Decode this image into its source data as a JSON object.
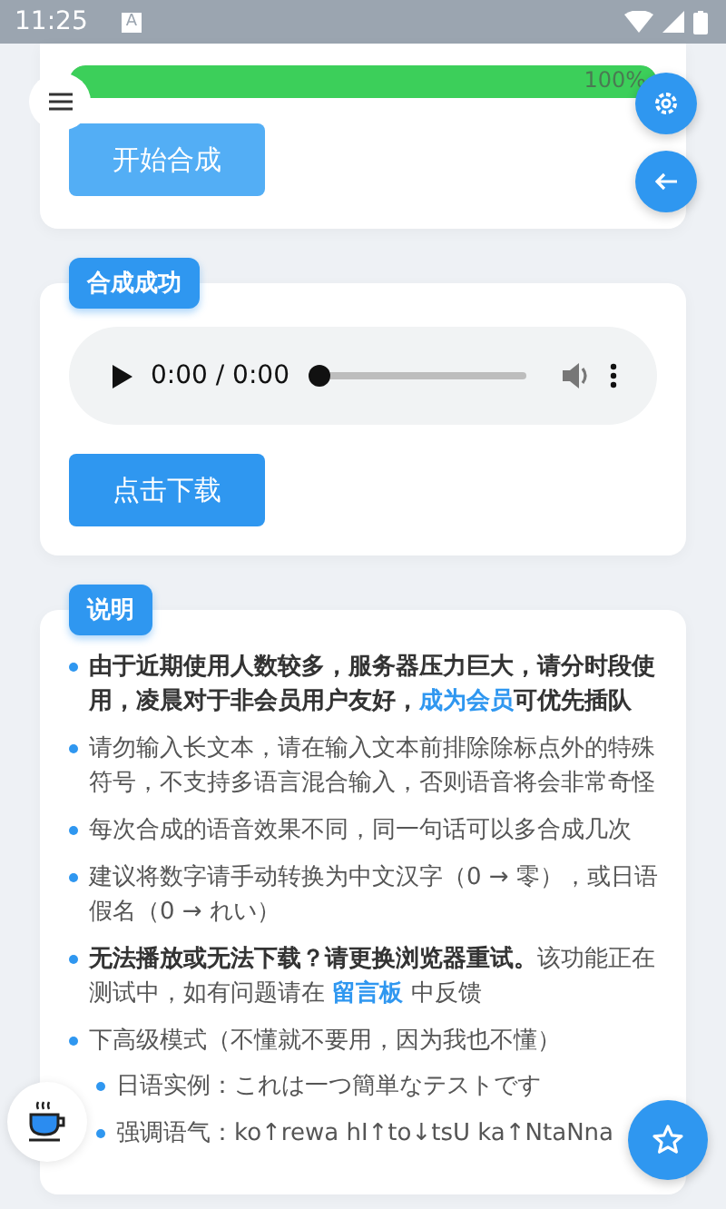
{
  "status_bar": {
    "time": "11:25",
    "badge": "A"
  },
  "progress": {
    "level": 1.0,
    "label": "100%"
  },
  "start_button": "开始合成",
  "result": {
    "tag": "合成成功",
    "player": {
      "time": "0:00 / 0:00",
      "level": 0.0
    },
    "download_button": "点击下载"
  },
  "notes": {
    "tag": "说明",
    "items": [
      {
        "segments": [
          {
            "kind": "bold",
            "text": "由于近期使用人数较多，服务器压力巨大，请分时段使用，凌晨对于非会员用户友好，"
          },
          {
            "kind": "link",
            "text": "成为会员"
          },
          {
            "kind": "bold",
            "text": "可优先插队"
          }
        ]
      },
      {
        "segments": [
          {
            "kind": "plain",
            "text": "请勿输入长文本，请在输入文本前排除除标点外的特殊符号，不支持多语言混合输入，否则语音将会非常奇怪"
          }
        ]
      },
      {
        "segments": [
          {
            "kind": "plain",
            "text": "每次合成的语音效果不同，同一句话可以多合成几次"
          }
        ]
      },
      {
        "segments": [
          {
            "kind": "plain",
            "text": "建议将数字请手动转换为中文汉字（0 → 零），或日语假名（0 → れい）"
          }
        ]
      },
      {
        "segments": [
          {
            "kind": "bold",
            "text": "无法播放或无法下载？请更换浏览器重试。"
          },
          {
            "kind": "plain",
            "text": "该功能正在测试中，如有问题请在 "
          },
          {
            "kind": "link",
            "text": "留言板"
          },
          {
            "kind": "plain",
            "text": " 中反馈"
          }
        ]
      },
      {
        "segments": [
          {
            "kind": "plain",
            "text": "下高级模式（不懂就不要用，因为我也不懂）"
          }
        ],
        "children": [
          {
            "segments": [
              {
                "kind": "plain",
                "text": "日语实例：これは一つ簡単なテストです"
              }
            ]
          },
          {
            "segments": [
              {
                "kind": "plain",
                "text": "强调语气：ko↑rewa hI↑to↓tsU ka↑NtaNna"
              }
            ]
          }
        ]
      }
    ]
  }
}
